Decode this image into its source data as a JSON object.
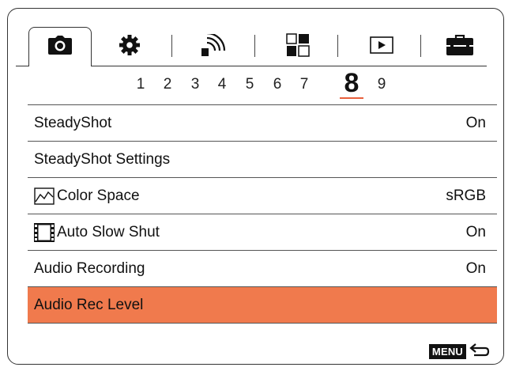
{
  "tabs": [
    {
      "name": "camera-icon",
      "active": true
    },
    {
      "name": "gear-icon",
      "active": false
    },
    {
      "name": "wireless-icon",
      "active": false
    },
    {
      "name": "custom-grid-icon",
      "active": false
    },
    {
      "name": "playback-icon",
      "active": false
    },
    {
      "name": "toolbox-icon",
      "active": false
    }
  ],
  "pages": [
    "1",
    "2",
    "3",
    "4",
    "5",
    "6",
    "7",
    "8",
    "9"
  ],
  "active_page": "8",
  "menu": {
    "items": [
      {
        "label": "SteadyShot",
        "value": "On",
        "icon": null
      },
      {
        "label": "SteadyShot Settings",
        "value": "",
        "icon": null
      },
      {
        "label": "Color Space",
        "value": "sRGB",
        "icon": "color-space-icon"
      },
      {
        "label": "Auto Slow Shut",
        "value": "On",
        "icon": "film-icon"
      },
      {
        "label": "Audio Recording",
        "value": "On",
        "icon": null
      },
      {
        "label": "Audio Rec Level",
        "value": "",
        "icon": null
      }
    ],
    "selected_index": 5
  },
  "footer": {
    "menu_label": "MENU",
    "back_icon": "back-arrow-icon"
  },
  "colors": {
    "accent": "#f07a4d",
    "underline": "#e8603c"
  }
}
